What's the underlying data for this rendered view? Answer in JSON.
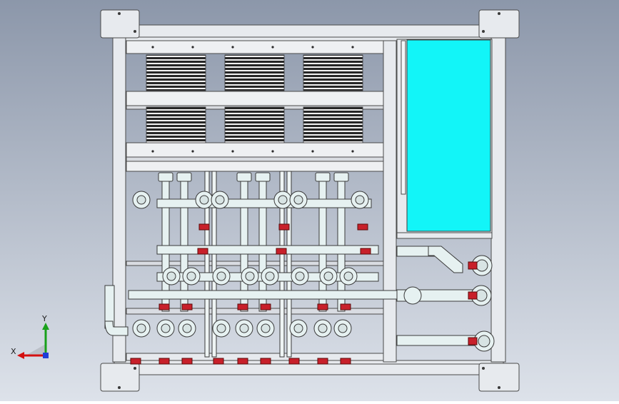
{
  "viewport": {
    "background_top": "#8c97aa",
    "background_bottom": "#dde2ea"
  },
  "colors": {
    "frame": "#e7eaee",
    "frame_edge": "#4a4a4a",
    "tank": "#12f5f8",
    "pipe": "#e6f1f1",
    "valve_red": "#c8202a",
    "axis_x": "#d41010",
    "axis_y": "#19a11b",
    "axis_z": "#1f3fd8"
  },
  "triad": {
    "x_label": "X",
    "y_label": "Y"
  }
}
